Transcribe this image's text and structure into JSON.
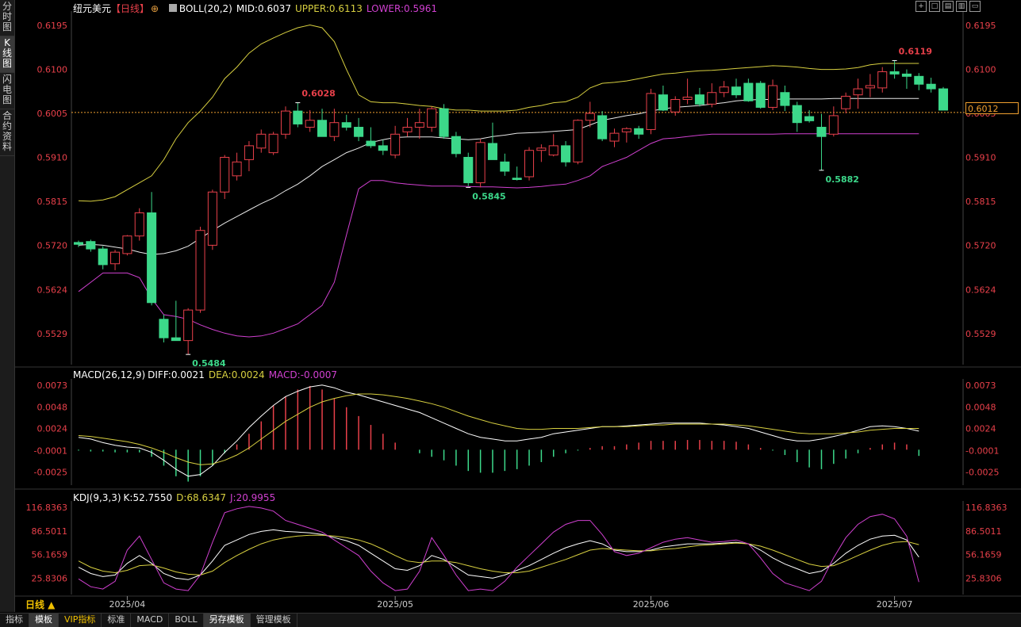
{
  "sidebar": {
    "items": [
      {
        "label": "分时图",
        "active": false
      },
      {
        "label": "K线图",
        "active": true
      },
      {
        "label": "闪电图",
        "active": false
      },
      {
        "label": "合约资料",
        "active": false
      }
    ]
  },
  "header": {
    "instrument": "纽元美元",
    "period_label": "【日线】",
    "indicator": "BOLL(20,2)",
    "mid": "MID:0.6037",
    "upper": "UPPER:0.6113",
    "lower": "LOWER:0.5961"
  },
  "toolbar_icons": [
    "crosshair-icon",
    "zoom-icon",
    "layout-icon",
    "settings-icon",
    "collapse-icon"
  ],
  "macd_header": {
    "name": "MACD(26,12,9)",
    "diff": "DIFF:0.0021",
    "dea": "DEA:0.0024",
    "macd": "MACD:-0.0007"
  },
  "kdj_header": {
    "name": "KDJ(9,3,3)",
    "k": "K:52.7550",
    "d": "D:68.6347",
    "j": "J:20.9955"
  },
  "current_price": "0.6012",
  "period_tag": "日线 ▲",
  "bottom_tabs": [
    {
      "label": "指标",
      "active": false,
      "vip": false
    },
    {
      "label": "模板",
      "active": true,
      "vip": false
    },
    {
      "label": "VIP指标",
      "active": false,
      "vip": true
    },
    {
      "label": "标准",
      "active": false,
      "vip": false
    },
    {
      "label": "MACD",
      "active": false,
      "vip": false
    },
    {
      "label": "BOLL",
      "active": false,
      "vip": false
    },
    {
      "label": "另存模板",
      "active": true,
      "vip": false
    },
    {
      "label": "管理模板",
      "active": false,
      "vip": false
    }
  ],
  "colors": {
    "up": "#e8404a",
    "down": "#3cd88a",
    "upper": "#d8d040",
    "mid": "#e8e8e8",
    "lower": "#d040d0",
    "diff": "#ffffff",
    "dea": "#d8d040",
    "k": "#ffffff",
    "d": "#d8d040",
    "j": "#d040d0",
    "axis": "#e8404a"
  },
  "chart_data": [
    {
      "type": "candlestick",
      "title": "纽元美元 日线",
      "ylim": [
        0.5462,
        0.6226
      ],
      "yticks": [
        "0.6195",
        "0.6100",
        "0.6005",
        "0.5910",
        "0.5815",
        "0.5720",
        "0.5624",
        "0.5529"
      ],
      "x_labels": [
        {
          "label": "2025/04",
          "index": 4
        },
        {
          "label": "2025/05",
          "index": 26
        },
        {
          "label": "2025/06",
          "index": 47
        },
        {
          "label": "2025/07",
          "index": 67
        }
      ],
      "annotations": [
        {
          "text": "0.6028",
          "index": 18,
          "value": 0.6028
        },
        {
          "text": "0.5845",
          "index": 32,
          "value": 0.5845
        },
        {
          "text": "0.5882",
          "index": 61,
          "value": 0.5882
        },
        {
          "text": "0.6119",
          "index": 67,
          "value": 0.6119
        },
        {
          "text": "0.5484",
          "index": 9,
          "value": 0.5484
        }
      ],
      "candles": [
        [
          0.5726,
          0.573,
          0.5716,
          0.5722
        ],
        [
          0.5728,
          0.5732,
          0.5706,
          0.5712
        ],
        [
          0.5712,
          0.5718,
          0.5668,
          0.5678
        ],
        [
          0.568,
          0.571,
          0.5666,
          0.5705
        ],
        [
          0.5702,
          0.5742,
          0.5698,
          0.574
        ],
        [
          0.574,
          0.58,
          0.573,
          0.579
        ],
        [
          0.579,
          0.5835,
          0.559,
          0.5596
        ],
        [
          0.556,
          0.557,
          0.551,
          0.552
        ],
        [
          0.552,
          0.56,
          0.5514,
          0.5514
        ],
        [
          0.5514,
          0.5584,
          0.5484,
          0.558
        ],
        [
          0.558,
          0.576,
          0.5574,
          0.5752
        ],
        [
          0.572,
          0.584,
          0.571,
          0.5835
        ],
        [
          0.5835,
          0.5915,
          0.582,
          0.591
        ],
        [
          0.587,
          0.592,
          0.586,
          0.59
        ],
        [
          0.5905,
          0.5945,
          0.588,
          0.5935
        ],
        [
          0.593,
          0.597,
          0.592,
          0.596
        ],
        [
          0.592,
          0.5965,
          0.5915,
          0.596
        ],
        [
          0.596,
          0.602,
          0.595,
          0.601
        ],
        [
          0.601,
          0.6028,
          0.5975,
          0.5982
        ],
        [
          0.5975,
          0.6012,
          0.5965,
          0.599
        ],
        [
          0.599,
          0.6015,
          0.5955,
          0.5955
        ],
        [
          0.5955,
          0.6015,
          0.5945,
          0.5985
        ],
        [
          0.5985,
          0.6002,
          0.5968,
          0.5975
        ],
        [
          0.5975,
          0.5995,
          0.5945,
          0.5955
        ],
        [
          0.5945,
          0.5975,
          0.593,
          0.5935
        ],
        [
          0.5935,
          0.5948,
          0.5915,
          0.5925
        ],
        [
          0.5915,
          0.5978,
          0.5908,
          0.596
        ],
        [
          0.5965,
          0.5995,
          0.5955,
          0.5975
        ],
        [
          0.5975,
          0.6015,
          0.595,
          0.5985
        ],
        [
          0.5975,
          0.602,
          0.5965,
          0.6015
        ],
        [
          0.6015,
          0.6025,
          0.595,
          0.5955
        ],
        [
          0.5955,
          0.5965,
          0.591,
          0.5918
        ],
        [
          0.591,
          0.592,
          0.5848,
          0.5855
        ],
        [
          0.5855,
          0.595,
          0.5845,
          0.5942
        ],
        [
          0.594,
          0.5985,
          0.5905,
          0.5905
        ],
        [
          0.59,
          0.5918,
          0.587,
          0.588
        ],
        [
          0.5865,
          0.589,
          0.586,
          0.5862
        ],
        [
          0.5868,
          0.5932,
          0.586,
          0.5925
        ],
        [
          0.5925,
          0.5938,
          0.59,
          0.593
        ],
        [
          0.5915,
          0.596,
          0.5912,
          0.5935
        ],
        [
          0.5935,
          0.5945,
          0.589,
          0.59
        ],
        [
          0.59,
          0.5992,
          0.5895,
          0.599
        ],
        [
          0.599,
          0.603,
          0.5975,
          0.6005
        ],
        [
          0.6,
          0.601,
          0.5945,
          0.595
        ],
        [
          0.5945,
          0.5972,
          0.5932,
          0.5962
        ],
        [
          0.5965,
          0.5975,
          0.5942,
          0.5972
        ],
        [
          0.5972,
          0.5978,
          0.595,
          0.596
        ],
        [
          0.597,
          0.6058,
          0.596,
          0.6048
        ],
        [
          0.6045,
          0.6065,
          0.601,
          0.6012
        ],
        [
          0.6008,
          0.6042,
          0.6,
          0.6035
        ],
        [
          0.6035,
          0.608,
          0.6025,
          0.604
        ],
        [
          0.6045,
          0.606,
          0.602,
          0.6025
        ],
        [
          0.6025,
          0.607,
          0.6018,
          0.605
        ],
        [
          0.605,
          0.6075,
          0.604,
          0.6062
        ],
        [
          0.6062,
          0.608,
          0.6038,
          0.6045
        ],
        [
          0.607,
          0.608,
          0.603,
          0.6032
        ],
        [
          0.607,
          0.6075,
          0.6015,
          0.6018
        ],
        [
          0.6018,
          0.6078,
          0.6012,
          0.6065
        ],
        [
          0.605,
          0.6065,
          0.601,
          0.6022
        ],
        [
          0.6022,
          0.603,
          0.5965,
          0.5985
        ],
        [
          0.5998,
          0.6012,
          0.5985,
          0.5989
        ],
        [
          0.5975,
          0.6004,
          0.5882,
          0.5955
        ],
        [
          0.596,
          0.602,
          0.5955,
          0.6
        ],
        [
          0.6015,
          0.605,
          0.6005,
          0.6042
        ],
        [
          0.6045,
          0.608,
          0.6015,
          0.6058
        ],
        [
          0.606,
          0.609,
          0.604,
          0.6065
        ],
        [
          0.606,
          0.6105,
          0.605,
          0.6095
        ],
        [
          0.6095,
          0.6119,
          0.608,
          0.609
        ],
        [
          0.609,
          0.61,
          0.6058,
          0.6085
        ],
        [
          0.6085,
          0.6092,
          0.6055,
          0.6068
        ],
        [
          0.6068,
          0.6082,
          0.605,
          0.6058
        ],
        [
          0.6058,
          0.6062,
          0.6012,
          0.6012
        ]
      ],
      "boll": {
        "upper": [
          0.5816,
          0.5815,
          0.5818,
          0.5825,
          0.584,
          0.5855,
          0.587,
          0.5905,
          0.595,
          0.5985,
          0.601,
          0.604,
          0.608,
          0.6105,
          0.6135,
          0.6155,
          0.6168,
          0.618,
          0.619,
          0.6196,
          0.619,
          0.616,
          0.61,
          0.6045,
          0.603,
          0.6028,
          0.6028,
          0.6025,
          0.6022,
          0.602,
          0.6015,
          0.6012,
          0.6012,
          0.601,
          0.601,
          0.601,
          0.6012,
          0.6018,
          0.6022,
          0.6028,
          0.603,
          0.604,
          0.606,
          0.607,
          0.6072,
          0.6075,
          0.608,
          0.6085,
          0.609,
          0.6092,
          0.6095,
          0.6097,
          0.6098,
          0.61,
          0.6102,
          0.6104,
          0.6106,
          0.6108,
          0.6107,
          0.6105,
          0.6102,
          0.61,
          0.61,
          0.6101,
          0.6104,
          0.611,
          0.6113,
          0.6113,
          0.6113,
          0.6113
        ],
        "mid": [
          0.572,
          0.5722,
          0.572,
          0.5716,
          0.5712,
          0.5705,
          0.57,
          0.5702,
          0.5708,
          0.5718,
          0.5735,
          0.5752,
          0.5768,
          0.5782,
          0.5796,
          0.581,
          0.5822,
          0.5838,
          0.5852,
          0.587,
          0.589,
          0.5905,
          0.592,
          0.593,
          0.5942,
          0.5948,
          0.5953,
          0.5954,
          0.5954,
          0.5954,
          0.5952,
          0.595,
          0.5948,
          0.595,
          0.5955,
          0.5958,
          0.5962,
          0.5963,
          0.5964,
          0.5966,
          0.5968,
          0.597,
          0.598,
          0.599,
          0.5995,
          0.6,
          0.6004,
          0.601,
          0.6015,
          0.6018,
          0.602,
          0.6022,
          0.6025,
          0.6028,
          0.6032,
          0.6034,
          0.6035,
          0.6035,
          0.6036,
          0.6036,
          0.6036,
          0.6036,
          0.6037,
          0.6037,
          0.6037,
          0.6037,
          0.6037,
          0.6037,
          0.6037,
          0.6037
        ],
        "lower": [
          0.562,
          0.564,
          0.566,
          0.566,
          0.566,
          0.565,
          0.5605,
          0.557,
          0.5566,
          0.556,
          0.5548,
          0.5538,
          0.553,
          0.5524,
          0.5522,
          0.5524,
          0.553,
          0.554,
          0.555,
          0.557,
          0.559,
          0.564,
          0.5742,
          0.5842,
          0.586,
          0.586,
          0.5855,
          0.5852,
          0.585,
          0.5848,
          0.5848,
          0.5848,
          0.5847,
          0.5846,
          0.5846,
          0.5845,
          0.5844,
          0.5845,
          0.5847,
          0.585,
          0.5852,
          0.586,
          0.587,
          0.589,
          0.59,
          0.591,
          0.5925,
          0.594,
          0.595,
          0.5952,
          0.5955,
          0.5958,
          0.596,
          0.596,
          0.596,
          0.596,
          0.596,
          0.596,
          0.5961,
          0.5961,
          0.5961,
          0.5961,
          0.5961,
          0.5961,
          0.5961,
          0.5961,
          0.5961,
          0.5961,
          0.5961,
          0.5961
        ]
      }
    },
    {
      "type": "bar+line",
      "title": "MACD(26,12,9)",
      "ylim": [
        -0.004,
        0.008
      ],
      "yticks": [
        "0.0073",
        "0.0048",
        "0.0024",
        "-0.0001",
        "-0.0025"
      ],
      "macd": [
        -0.0001,
        -0.0002,
        -0.0002,
        -0.0003,
        -0.0003,
        -0.0003,
        -0.0008,
        -0.0018,
        -0.003,
        -0.0036,
        -0.003,
        -0.0018,
        -0.0004,
        0.0006,
        0.0018,
        0.0032,
        0.005,
        0.006,
        0.0068,
        0.0072,
        0.0068,
        0.0058,
        0.0048,
        0.0038,
        0.0028,
        0.0018,
        0.0008,
        0.0,
        -0.0004,
        -0.0008,
        -0.0012,
        -0.0018,
        -0.0024,
        -0.0026,
        -0.0026,
        -0.0024,
        -0.0022,
        -0.0018,
        -0.0014,
        -0.0008,
        -0.0004,
        -0.0001,
        0.0002,
        0.0004,
        0.0004,
        0.0006,
        0.0008,
        0.001,
        0.001,
        0.001,
        0.0011,
        0.0011,
        0.001,
        0.001,
        0.0009,
        0.0006,
        0.0002,
        -0.0001,
        -0.0006,
        -0.0014,
        -0.002,
        -0.0022,
        -0.0016,
        -0.001,
        -0.0004,
        0.0002,
        0.0006,
        0.0008,
        0.0006,
        -0.0007
      ],
      "diff": [
        0.0014,
        0.0012,
        0.0008,
        0.0005,
        0.0003,
        0.0002,
        -0.0003,
        -0.0012,
        -0.0022,
        -0.003,
        -0.0028,
        -0.0018,
        -0.0003,
        0.001,
        0.0025,
        0.0038,
        0.005,
        0.006,
        0.0066,
        0.0071,
        0.0073,
        0.007,
        0.0065,
        0.0062,
        0.0058,
        0.0054,
        0.005,
        0.0046,
        0.0042,
        0.0036,
        0.003,
        0.0024,
        0.0018,
        0.0014,
        0.0012,
        0.001,
        0.001,
        0.0012,
        0.0014,
        0.0018,
        0.002,
        0.0022,
        0.0024,
        0.0026,
        0.0026,
        0.0027,
        0.0028,
        0.0029,
        0.003,
        0.003,
        0.003,
        0.003,
        0.0029,
        0.0028,
        0.0026,
        0.0024,
        0.002,
        0.0016,
        0.0012,
        0.001,
        0.001,
        0.0012,
        0.0015,
        0.0018,
        0.0022,
        0.0026,
        0.0027,
        0.0026,
        0.0024,
        0.0021
      ],
      "dea": [
        0.0016,
        0.0015,
        0.0013,
        0.0011,
        0.0009,
        0.0006,
        0.0002,
        -0.0003,
        -0.0009,
        -0.0014,
        -0.0017,
        -0.0016,
        -0.0012,
        -0.0006,
        0.0002,
        0.0012,
        0.0022,
        0.0032,
        0.004,
        0.0048,
        0.0054,
        0.0058,
        0.0061,
        0.0063,
        0.0063,
        0.0062,
        0.006,
        0.0058,
        0.0055,
        0.0052,
        0.0048,
        0.0043,
        0.0038,
        0.0034,
        0.003,
        0.0027,
        0.0024,
        0.0023,
        0.0023,
        0.0024,
        0.0024,
        0.0024,
        0.0025,
        0.0026,
        0.0026,
        0.0026,
        0.0027,
        0.0028,
        0.0028,
        0.0029,
        0.0029,
        0.0029,
        0.0029,
        0.0029,
        0.0028,
        0.0027,
        0.0025,
        0.0023,
        0.0021,
        0.0019,
        0.0018,
        0.0018,
        0.0018,
        0.0019,
        0.002,
        0.0022,
        0.0023,
        0.0024,
        0.0024,
        0.0024
      ]
    },
    {
      "type": "line",
      "title": "KDJ(9,3,3)",
      "ylim": [
        5,
        125
      ],
      "yticks": [
        "116.8363",
        "86.5011",
        "56.1659",
        "25.8306"
      ],
      "k": [
        40,
        32,
        28,
        30,
        45,
        55,
        45,
        32,
        26,
        24,
        30,
        48,
        68,
        75,
        82,
        86,
        88,
        86,
        85,
        84,
        82,
        78,
        74,
        68,
        58,
        48,
        38,
        36,
        42,
        55,
        50,
        40,
        30,
        28,
        26,
        30,
        36,
        42,
        50,
        58,
        65,
        70,
        74,
        70,
        62,
        60,
        60,
        62,
        66,
        68,
        70,
        70,
        70,
        71,
        72,
        70,
        62,
        52,
        44,
        38,
        32,
        35,
        45,
        58,
        68,
        76,
        80,
        81,
        75,
        53
      ],
      "d": [
        48,
        40,
        35,
        33,
        36,
        42,
        43,
        39,
        34,
        31,
        30,
        35,
        46,
        55,
        63,
        70,
        75,
        78,
        80,
        81,
        81,
        80,
        78,
        75,
        70,
        63,
        55,
        48,
        46,
        48,
        48,
        46,
        42,
        38,
        35,
        33,
        33,
        35,
        40,
        45,
        50,
        56,
        62,
        64,
        63,
        62,
        61,
        61,
        63,
        64,
        66,
        68,
        69,
        70,
        71,
        70,
        67,
        62,
        56,
        50,
        44,
        41,
        42,
        48,
        55,
        62,
        68,
        72,
        73,
        69
      ],
      "j": [
        25,
        15,
        12,
        22,
        62,
        80,
        50,
        20,
        12,
        10,
        30,
        72,
        110,
        115,
        118,
        116,
        112,
        100,
        95,
        90,
        85,
        75,
        65,
        55,
        35,
        20,
        10,
        12,
        35,
        78,
        55,
        30,
        10,
        12,
        10,
        22,
        40,
        55,
        70,
        85,
        95,
        100,
        100,
        82,
        60,
        55,
        58,
        65,
        72,
        76,
        78,
        75,
        72,
        73,
        75,
        70,
        52,
        32,
        20,
        15,
        10,
        22,
        52,
        78,
        95,
        105,
        108,
        102,
        80,
        21
      ]
    }
  ]
}
